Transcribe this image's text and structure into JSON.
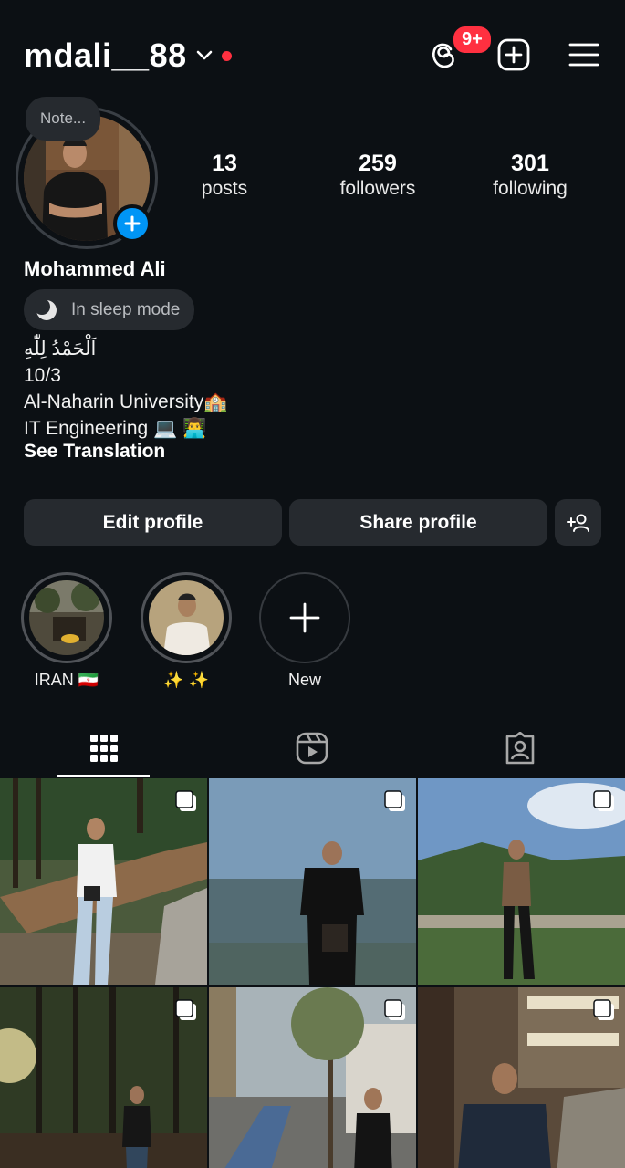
{
  "header": {
    "username": "mdali__88",
    "threads_badge": "9+",
    "icons": [
      "chevron-down-icon",
      "threads-icon",
      "create-icon",
      "menu-icon"
    ]
  },
  "profile": {
    "note_placeholder": "Note...",
    "stats": [
      {
        "num": "13",
        "label": "posts"
      },
      {
        "num": "259",
        "label": "followers"
      },
      {
        "num": "301",
        "label": "following"
      }
    ],
    "full_name": "Mohammed Ali",
    "status_pill": "In sleep mode",
    "bio_lines": [
      "اَلْحَمْدُ لِلّٰهِ",
      "10/3",
      "Al-Naharin University🏫",
      "IT Engineering 💻 👨‍💻"
    ],
    "see_translation": "See Translation"
  },
  "buttons": {
    "edit": "Edit profile",
    "share": "Share profile"
  },
  "highlights": [
    {
      "label": "IRAN 🇮🇷"
    },
    {
      "label": "✨ ✨"
    },
    {
      "label": "New"
    }
  ],
  "colors": {
    "background": "#0c1014",
    "surface": "#262a2f",
    "accent": "#0095f6",
    "badge": "#ff3040"
  }
}
